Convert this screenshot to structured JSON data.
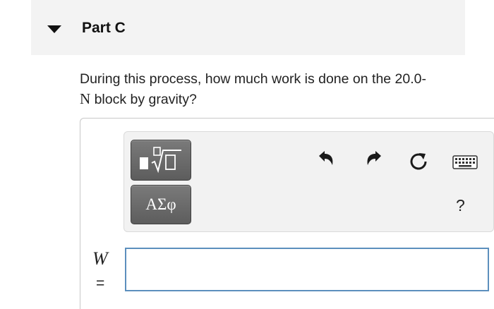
{
  "part": {
    "title": "Part C",
    "expanded_icon": "caret-down-icon"
  },
  "question": {
    "text_before": "During this process, how much work is done on the 20.0-",
    "unit": "N",
    "text_after": " block by gravity?"
  },
  "toolbar": {
    "templates_icon": "fraction-radical-templates-icon",
    "symbols_label": "ΑΣφ",
    "undo_icon": "undo-icon",
    "redo_icon": "redo-icon",
    "reset_icon": "reset-icon",
    "keyboard_icon": "keyboard-icon",
    "help_label": "?"
  },
  "answer": {
    "variable": "W",
    "equals": "=",
    "value": "",
    "placeholder": ""
  },
  "colors": {
    "header_bg": "#f3f3f3",
    "toolbar_bg": "#f2f2f2",
    "button_bg": "#666666",
    "input_border": "#5c8fbd"
  }
}
